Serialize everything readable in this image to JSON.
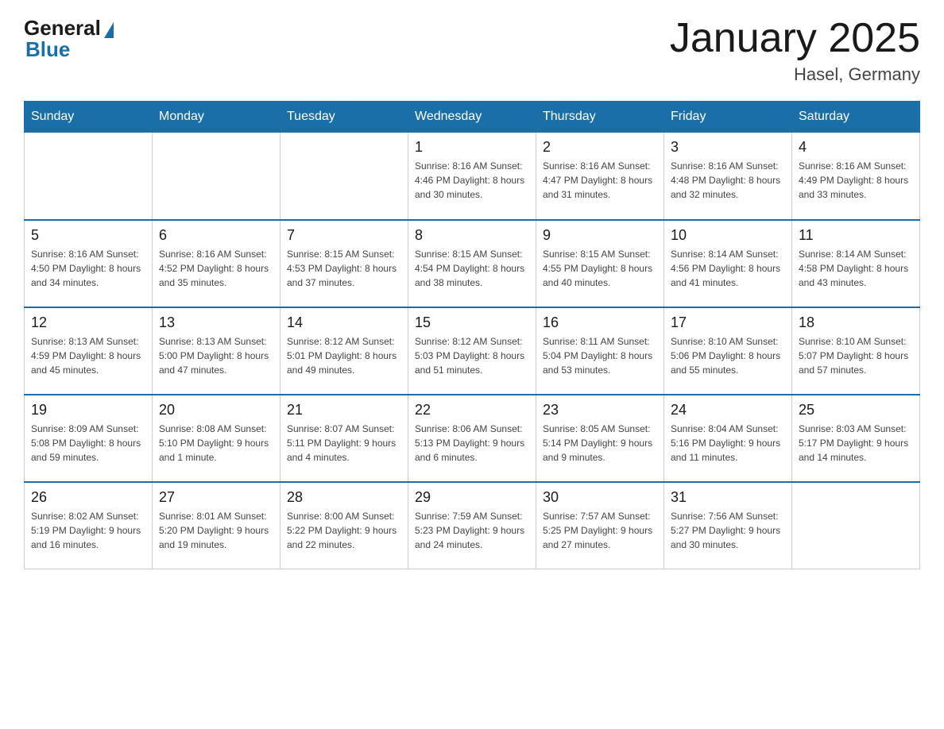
{
  "header": {
    "logo": {
      "general": "General",
      "blue": "Blue"
    },
    "title": "January 2025",
    "location": "Hasel, Germany"
  },
  "calendar": {
    "days_of_week": [
      "Sunday",
      "Monday",
      "Tuesday",
      "Wednesday",
      "Thursday",
      "Friday",
      "Saturday"
    ],
    "weeks": [
      [
        {
          "day": "",
          "info": ""
        },
        {
          "day": "",
          "info": ""
        },
        {
          "day": "",
          "info": ""
        },
        {
          "day": "1",
          "info": "Sunrise: 8:16 AM\nSunset: 4:46 PM\nDaylight: 8 hours\nand 30 minutes."
        },
        {
          "day": "2",
          "info": "Sunrise: 8:16 AM\nSunset: 4:47 PM\nDaylight: 8 hours\nand 31 minutes."
        },
        {
          "day": "3",
          "info": "Sunrise: 8:16 AM\nSunset: 4:48 PM\nDaylight: 8 hours\nand 32 minutes."
        },
        {
          "day": "4",
          "info": "Sunrise: 8:16 AM\nSunset: 4:49 PM\nDaylight: 8 hours\nand 33 minutes."
        }
      ],
      [
        {
          "day": "5",
          "info": "Sunrise: 8:16 AM\nSunset: 4:50 PM\nDaylight: 8 hours\nand 34 minutes."
        },
        {
          "day": "6",
          "info": "Sunrise: 8:16 AM\nSunset: 4:52 PM\nDaylight: 8 hours\nand 35 minutes."
        },
        {
          "day": "7",
          "info": "Sunrise: 8:15 AM\nSunset: 4:53 PM\nDaylight: 8 hours\nand 37 minutes."
        },
        {
          "day": "8",
          "info": "Sunrise: 8:15 AM\nSunset: 4:54 PM\nDaylight: 8 hours\nand 38 minutes."
        },
        {
          "day": "9",
          "info": "Sunrise: 8:15 AM\nSunset: 4:55 PM\nDaylight: 8 hours\nand 40 minutes."
        },
        {
          "day": "10",
          "info": "Sunrise: 8:14 AM\nSunset: 4:56 PM\nDaylight: 8 hours\nand 41 minutes."
        },
        {
          "day": "11",
          "info": "Sunrise: 8:14 AM\nSunset: 4:58 PM\nDaylight: 8 hours\nand 43 minutes."
        }
      ],
      [
        {
          "day": "12",
          "info": "Sunrise: 8:13 AM\nSunset: 4:59 PM\nDaylight: 8 hours\nand 45 minutes."
        },
        {
          "day": "13",
          "info": "Sunrise: 8:13 AM\nSunset: 5:00 PM\nDaylight: 8 hours\nand 47 minutes."
        },
        {
          "day": "14",
          "info": "Sunrise: 8:12 AM\nSunset: 5:01 PM\nDaylight: 8 hours\nand 49 minutes."
        },
        {
          "day": "15",
          "info": "Sunrise: 8:12 AM\nSunset: 5:03 PM\nDaylight: 8 hours\nand 51 minutes."
        },
        {
          "day": "16",
          "info": "Sunrise: 8:11 AM\nSunset: 5:04 PM\nDaylight: 8 hours\nand 53 minutes."
        },
        {
          "day": "17",
          "info": "Sunrise: 8:10 AM\nSunset: 5:06 PM\nDaylight: 8 hours\nand 55 minutes."
        },
        {
          "day": "18",
          "info": "Sunrise: 8:10 AM\nSunset: 5:07 PM\nDaylight: 8 hours\nand 57 minutes."
        }
      ],
      [
        {
          "day": "19",
          "info": "Sunrise: 8:09 AM\nSunset: 5:08 PM\nDaylight: 8 hours\nand 59 minutes."
        },
        {
          "day": "20",
          "info": "Sunrise: 8:08 AM\nSunset: 5:10 PM\nDaylight: 9 hours\nand 1 minute."
        },
        {
          "day": "21",
          "info": "Sunrise: 8:07 AM\nSunset: 5:11 PM\nDaylight: 9 hours\nand 4 minutes."
        },
        {
          "day": "22",
          "info": "Sunrise: 8:06 AM\nSunset: 5:13 PM\nDaylight: 9 hours\nand 6 minutes."
        },
        {
          "day": "23",
          "info": "Sunrise: 8:05 AM\nSunset: 5:14 PM\nDaylight: 9 hours\nand 9 minutes."
        },
        {
          "day": "24",
          "info": "Sunrise: 8:04 AM\nSunset: 5:16 PM\nDaylight: 9 hours\nand 11 minutes."
        },
        {
          "day": "25",
          "info": "Sunrise: 8:03 AM\nSunset: 5:17 PM\nDaylight: 9 hours\nand 14 minutes."
        }
      ],
      [
        {
          "day": "26",
          "info": "Sunrise: 8:02 AM\nSunset: 5:19 PM\nDaylight: 9 hours\nand 16 minutes."
        },
        {
          "day": "27",
          "info": "Sunrise: 8:01 AM\nSunset: 5:20 PM\nDaylight: 9 hours\nand 19 minutes."
        },
        {
          "day": "28",
          "info": "Sunrise: 8:00 AM\nSunset: 5:22 PM\nDaylight: 9 hours\nand 22 minutes."
        },
        {
          "day": "29",
          "info": "Sunrise: 7:59 AM\nSunset: 5:23 PM\nDaylight: 9 hours\nand 24 minutes."
        },
        {
          "day": "30",
          "info": "Sunrise: 7:57 AM\nSunset: 5:25 PM\nDaylight: 9 hours\nand 27 minutes."
        },
        {
          "day": "31",
          "info": "Sunrise: 7:56 AM\nSunset: 5:27 PM\nDaylight: 9 hours\nand 30 minutes."
        },
        {
          "day": "",
          "info": ""
        }
      ]
    ]
  }
}
